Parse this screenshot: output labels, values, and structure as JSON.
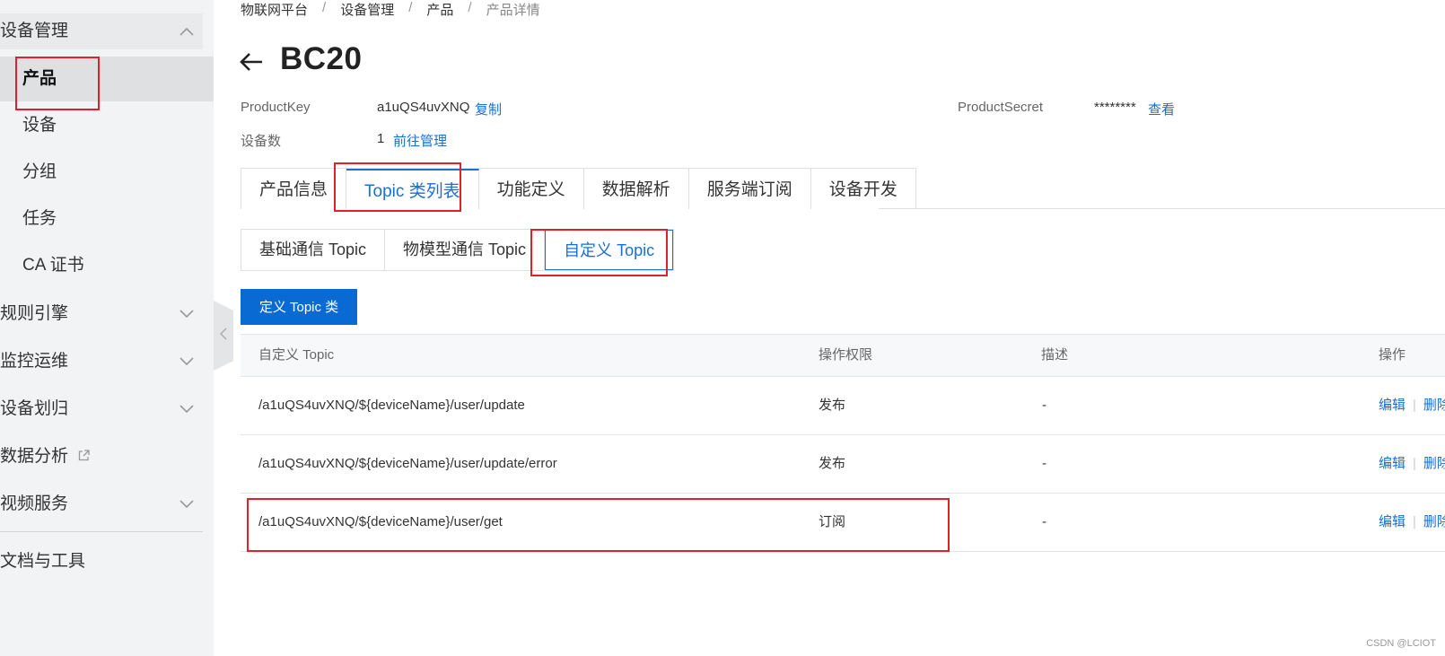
{
  "sidebar": {
    "groups": [
      {
        "label": "设备管理",
        "icon": "chevron-up-icon"
      },
      {
        "label": "规则引擎",
        "icon": "chevron-down-icon"
      },
      {
        "label": "监控运维",
        "icon": "chevron-down-icon"
      },
      {
        "label": "设备划归",
        "icon": "chevron-down-icon"
      },
      {
        "label": "数据分析",
        "icon": "external-link-icon"
      },
      {
        "label": "视频服务",
        "icon": "chevron-down-icon"
      },
      {
        "label": "文档与工具"
      }
    ],
    "sub_items": [
      {
        "label": "产品",
        "active": true
      },
      {
        "label": "设备"
      },
      {
        "label": "分组"
      },
      {
        "label": "任务"
      },
      {
        "label": "CA 证书"
      }
    ]
  },
  "breadcrumb": [
    "物联网平台",
    "设备管理",
    "产品",
    "产品详情"
  ],
  "breadcrumb_sep": "/",
  "header": {
    "title": "BC20"
  },
  "info": {
    "product_key_label": "ProductKey",
    "product_key_value": "a1uQS4uvXNQ",
    "copy_link": "复制",
    "product_secret_label": "ProductSecret",
    "product_secret_value": "********",
    "view_link": "查看",
    "device_count_label": "设备数",
    "device_count_value": "1",
    "manage_link": "前往管理"
  },
  "tabs": [
    "产品信息",
    "Topic 类列表",
    "功能定义",
    "数据解析",
    "服务端订阅",
    "设备开发"
  ],
  "active_tab": 1,
  "subtabs": [
    "基础通信 Topic",
    "物模型通信 Topic",
    "自定义 Topic"
  ],
  "active_subtab": 2,
  "toolbar": {
    "define_button": "定义 Topic 类"
  },
  "table": {
    "headers": [
      "自定义 Topic",
      "操作权限",
      "描述",
      "操作"
    ],
    "rows": [
      {
        "topic": "/a1uQS4uvXNQ/${deviceName}/user/update",
        "permission": "发布",
        "desc": "-",
        "edit": "编辑",
        "delete": "删除"
      },
      {
        "topic": "/a1uQS4uvXNQ/${deviceName}/user/update/error",
        "permission": "发布",
        "desc": "-",
        "edit": "编辑",
        "delete": "删除"
      },
      {
        "topic": "/a1uQS4uvXNQ/${deviceName}/user/get",
        "permission": "订阅",
        "desc": "-",
        "edit": "编辑",
        "delete": "删除"
      }
    ]
  },
  "watermark": "CSDN @LCIOT",
  "colors": {
    "accent": "#1a6fd1",
    "primary_button": "#0a6ad4",
    "annotation": "#e0202a",
    "sidebar_bg": "#f2f3f5"
  }
}
